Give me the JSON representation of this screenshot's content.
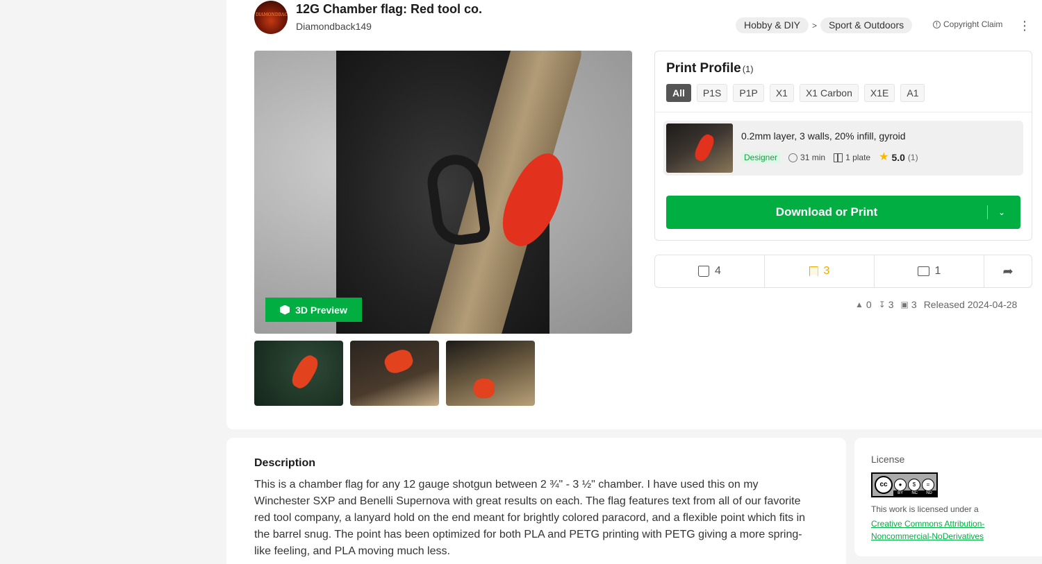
{
  "model": {
    "title": "12G Chamber flag: Red tool co.",
    "author": "Diamondback149",
    "avatar_text": "DIAMONDBACK149"
  },
  "breadcrumb": [
    "Hobby & DIY",
    "Sport & Outdoors"
  ],
  "breadcrumb_sep": ">",
  "copyright_label": "Copyright Claim",
  "preview_label": "3D Preview",
  "print_profile": {
    "title": "Print Profile",
    "count": "(1)",
    "filters": [
      "All",
      "P1S",
      "P1P",
      "X1",
      "X1 Carbon",
      "X1E",
      "A1"
    ],
    "active_filter": "All",
    "item": {
      "name": "0.2mm layer, 3 walls, 20% infill, gyroid",
      "badge": "Designer",
      "time": "31 min",
      "plates": "1 plate",
      "rating": "5.0",
      "rating_count": "(1)"
    },
    "download_label": "Download or Print"
  },
  "actions": {
    "likes": "4",
    "favorites": "3",
    "comments": "1"
  },
  "stats": {
    "boosts": "0",
    "downloads": "3",
    "prints": "3",
    "released": "Released 2024-04-28"
  },
  "description": {
    "heading": "Description",
    "body": "This is a chamber flag for any 12 gauge shotgun between 2 ¾\" - 3 ½\" chamber. I have used this on my Winchester SXP and Benelli Supernova with great results on each. The flag features text from all of our favorite red tool company, a lanyard hold on the end meant for brightly colored paracord, and a flexible point which fits in the barrel snug. The point has been optimized for both PLA and PETG printing with PETG giving a more spring-like feeling, and PLA moving much less."
  },
  "license": {
    "heading": "License",
    "badge_labels": [
      "BY",
      "NC",
      "ND"
    ],
    "text": "This work is licensed under a",
    "link": "Creative Commons Attribution-Noncommercial-NoDerivatives"
  },
  "colors": {
    "accent": "#00ae42",
    "favorite": "#f0a500",
    "background": "#f4f4f4"
  }
}
